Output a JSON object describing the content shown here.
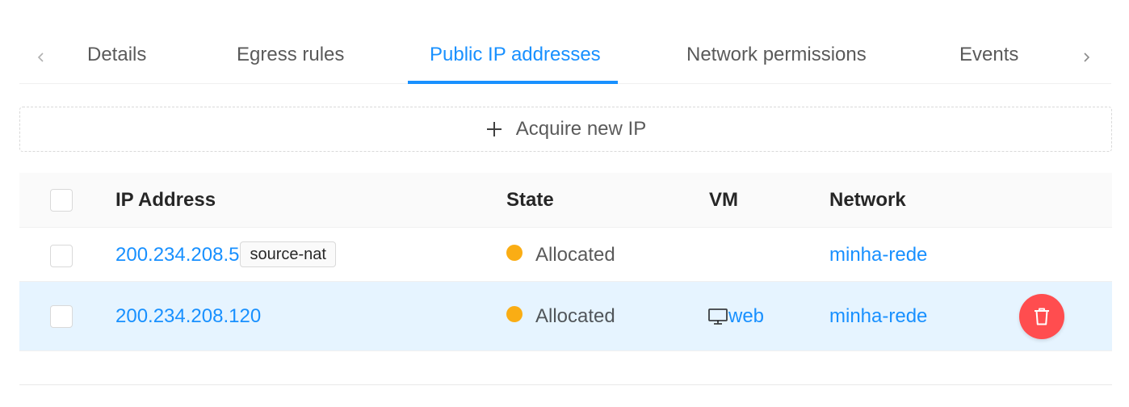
{
  "tabs": {
    "items": [
      {
        "label": "Details"
      },
      {
        "label": "Egress rules"
      },
      {
        "label": "Public IP addresses"
      },
      {
        "label": "Network permissions"
      },
      {
        "label": "Events"
      }
    ],
    "active": "Public IP addresses"
  },
  "acquire_button": {
    "label": "Acquire new IP"
  },
  "table": {
    "columns": [
      "IP Address",
      "State",
      "VM",
      "Network"
    ],
    "rows": [
      {
        "ip": "200.234.208.5",
        "tag": "source-nat",
        "state": "Allocated",
        "vm": "",
        "network": "minha-rede"
      },
      {
        "ip": "200.234.208.120",
        "tag": "",
        "state": "Allocated",
        "vm": "web",
        "network": "minha-rede"
      }
    ]
  },
  "icons": {
    "tab_prev": "chevron-left-icon",
    "tab_next": "chevron-right-icon",
    "acquire": "plus-icon",
    "vm": "desktop-icon",
    "delete": "trash-icon"
  },
  "colors": {
    "accent": "#1890ff",
    "allocated": "#faad14",
    "selected_row": "#e6f4ff",
    "danger": "#ff4d4f"
  }
}
